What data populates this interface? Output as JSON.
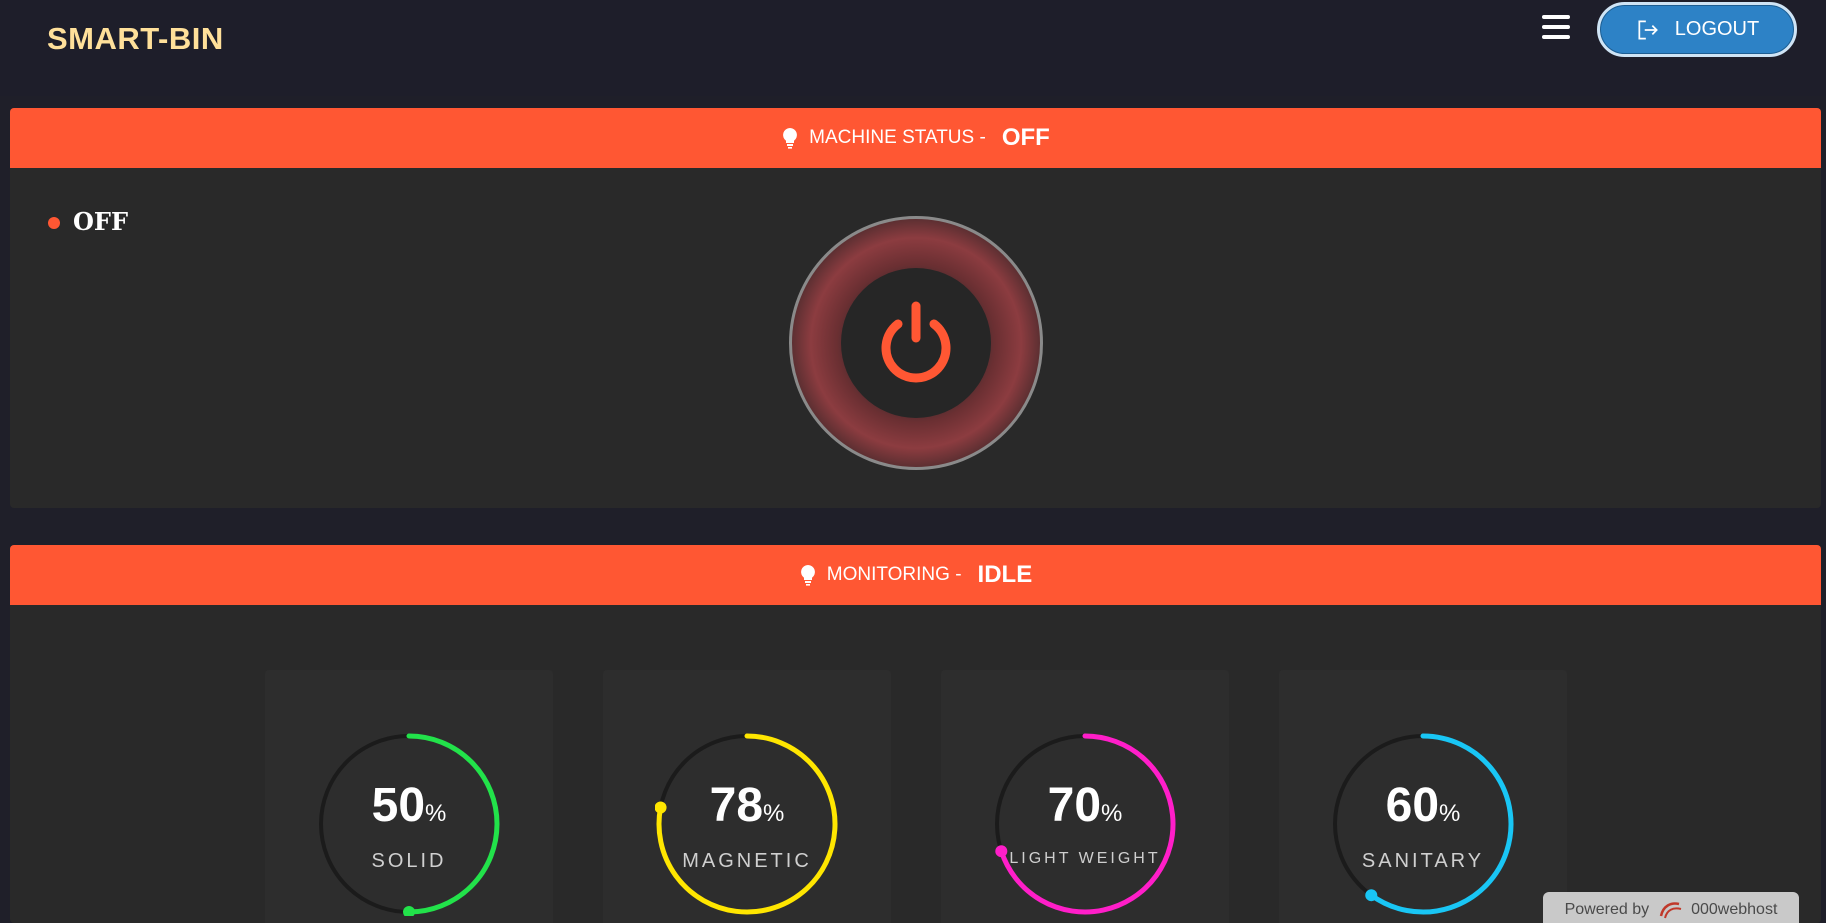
{
  "header": {
    "brand": "SMART-BIN",
    "logout_label": "LOGOUT"
  },
  "machine_panel": {
    "title": "MACHINE STATUS -",
    "status_value": "OFF",
    "indicator_text": "OFF"
  },
  "monitoring_panel": {
    "title": "MONITORING -",
    "status_value": "IDLE",
    "gauges": [
      {
        "value": "50",
        "unit": "%",
        "label": "SOLID",
        "color": "#22e24a",
        "fraction": 0.5
      },
      {
        "value": "78",
        "unit": "%",
        "label": "MAGNETIC",
        "color": "#ffe600",
        "fraction": 0.78
      },
      {
        "value": "70",
        "unit": "%",
        "label": "LIGHT WEIGHT",
        "color": "#ff1ec9",
        "fraction": 0.7
      },
      {
        "value": "60",
        "unit": "%",
        "label": "SANITARY",
        "color": "#19c6f5",
        "fraction": 0.6
      }
    ]
  },
  "footer": {
    "powered_by": "Powered by",
    "host": "000webhost"
  },
  "colors": {
    "accent": "#ff5733",
    "logout_bg": "#2d82c6",
    "brand": "#ffe09a"
  }
}
